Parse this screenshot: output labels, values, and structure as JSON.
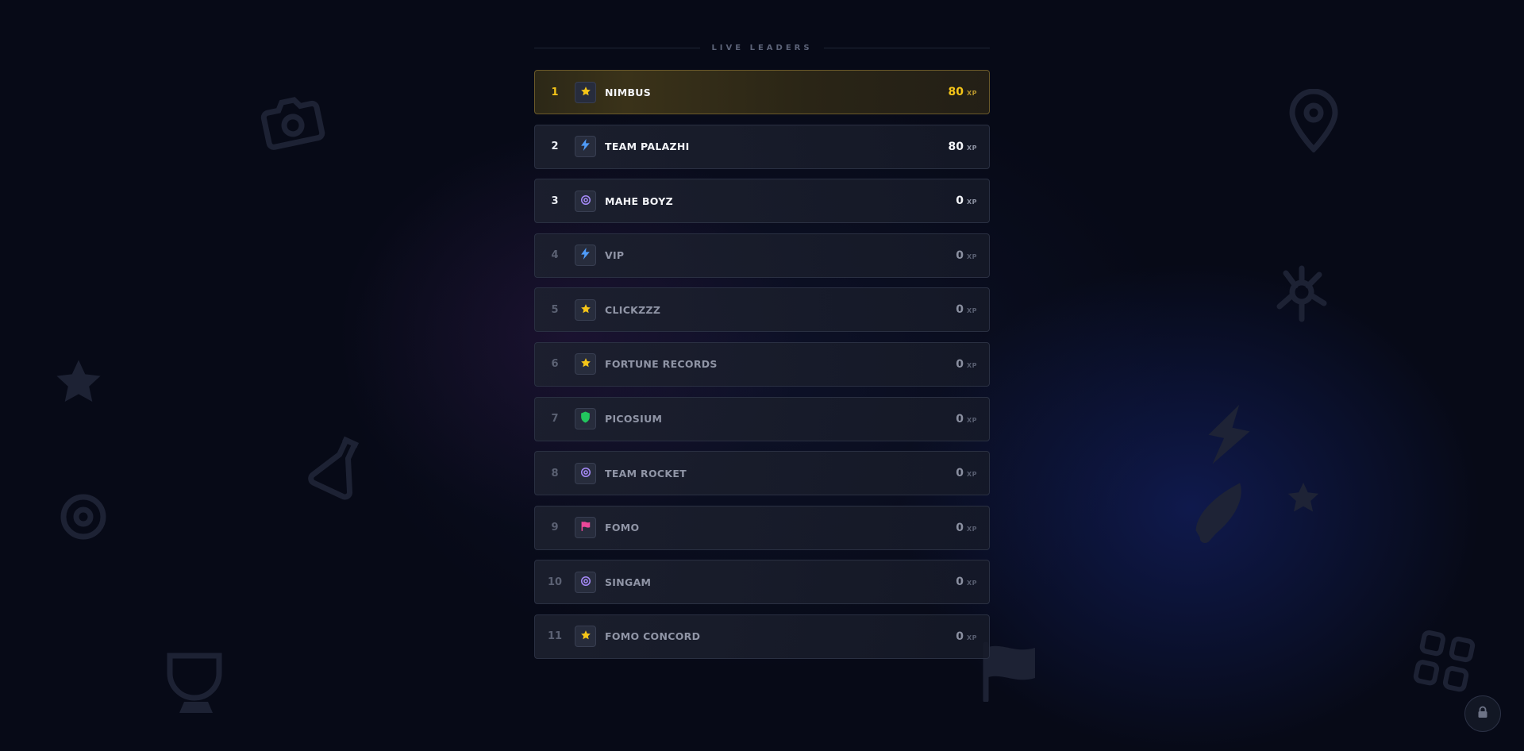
{
  "header": {
    "title": "LIVE LEADERS"
  },
  "colors": {
    "gold": "#f5c518",
    "blue": "#4f9cf9",
    "purple": "#a78bfa",
    "green": "#22c55e",
    "pink": "#ec4899"
  },
  "leaders": [
    {
      "rank": "1",
      "name": "NIMBUS",
      "score": "80",
      "unit": "XP",
      "icon": "star-icon"
    },
    {
      "rank": "2",
      "name": "TEAM PALAZHI",
      "score": "80",
      "unit": "XP",
      "icon": "bolt-icon"
    },
    {
      "rank": "3",
      "name": "MAHE BOYZ",
      "score": "0",
      "unit": "XP",
      "icon": "target-icon"
    },
    {
      "rank": "4",
      "name": "VIP",
      "score": "0",
      "unit": "XP",
      "icon": "bolt-icon"
    },
    {
      "rank": "5",
      "name": "CLICKZZZ",
      "score": "0",
      "unit": "XP",
      "icon": "star-icon"
    },
    {
      "rank": "6",
      "name": "FORTUNE RECORDS",
      "score": "0",
      "unit": "XP",
      "icon": "star-icon"
    },
    {
      "rank": "7",
      "name": "PICOSIUM",
      "score": "0",
      "unit": "XP",
      "icon": "shield-icon"
    },
    {
      "rank": "8",
      "name": "TEAM ROCKET",
      "score": "0",
      "unit": "XP",
      "icon": "target-icon"
    },
    {
      "rank": "9",
      "name": "FOMO",
      "score": "0",
      "unit": "XP",
      "icon": "flag-icon"
    },
    {
      "rank": "10",
      "name": "SINGAM",
      "score": "0",
      "unit": "XP",
      "icon": "target-icon"
    },
    {
      "rank": "11",
      "name": "FOMO CONCORD",
      "score": "0",
      "unit": "XP",
      "icon": "star-icon"
    }
  ],
  "lock_button": {
    "icon": "lock-icon"
  }
}
